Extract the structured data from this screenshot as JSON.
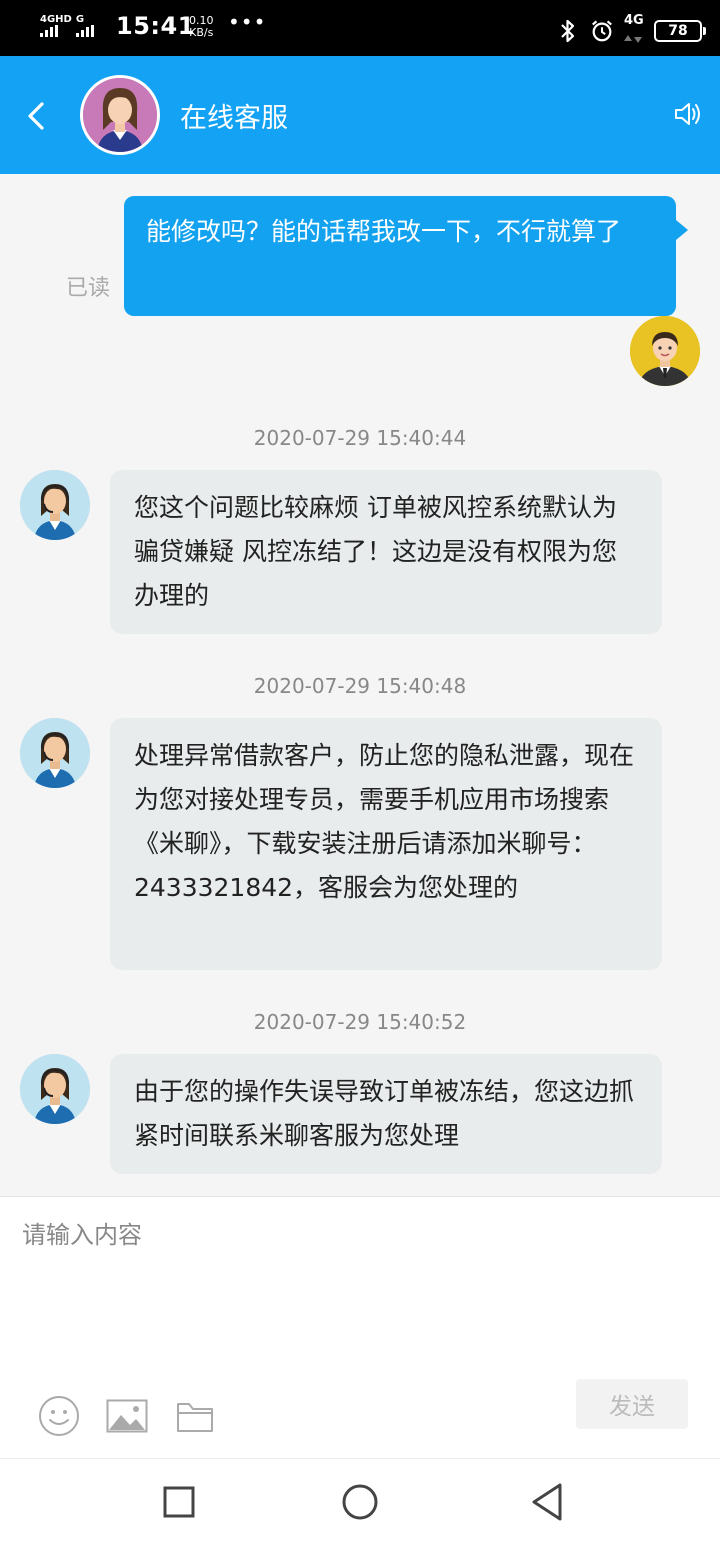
{
  "status_bar": {
    "network_1": "4GHD",
    "network_2": "G",
    "time": "15:41",
    "speed_value": "0.10",
    "speed_unit": "KB/s",
    "more": "•••",
    "right_network": "4G",
    "battery": "78"
  },
  "header": {
    "title": "在线客服"
  },
  "messages": {
    "m1": {
      "text": "能修改吗？能的话帮我改一下，不行就算了",
      "read_status": "已读"
    },
    "m2": {
      "time": "2020-07-29 15:40:44",
      "text": "您这个问题比较麻烦 订单被风控系统默认为骗贷嫌疑 风控冻结了！这边是没有权限为您办理的"
    },
    "m3": {
      "time": "2020-07-29 15:40:48",
      "text": "处理异常借款客户，防止您的隐私泄露，现在为您对接处理专员，需要手机应用市场搜索《米聊》，下载安装注册后请添加米聊号： 2433321842，客服会为您处理的"
    },
    "m4": {
      "time": "2020-07-29 15:40:52",
      "text": "由于您的操作失误导致订单被冻结，您这边抓紧时间联系米聊客服为您处理"
    }
  },
  "composer": {
    "placeholder": "请输入内容",
    "send_label": "发送"
  },
  "icons": {
    "back": "back-chevron-icon",
    "speaker": "speaker-icon",
    "emoji": "smiley-icon",
    "image": "image-icon",
    "folder": "folder-icon",
    "nav_recents": "square-icon",
    "nav_home": "circle-icon",
    "nav_back": "triangle-back-icon"
  },
  "colors": {
    "header": "#14a3f4",
    "outgoing_bubble": "#12a2f0",
    "incoming_bubble": "#e8ecec"
  }
}
